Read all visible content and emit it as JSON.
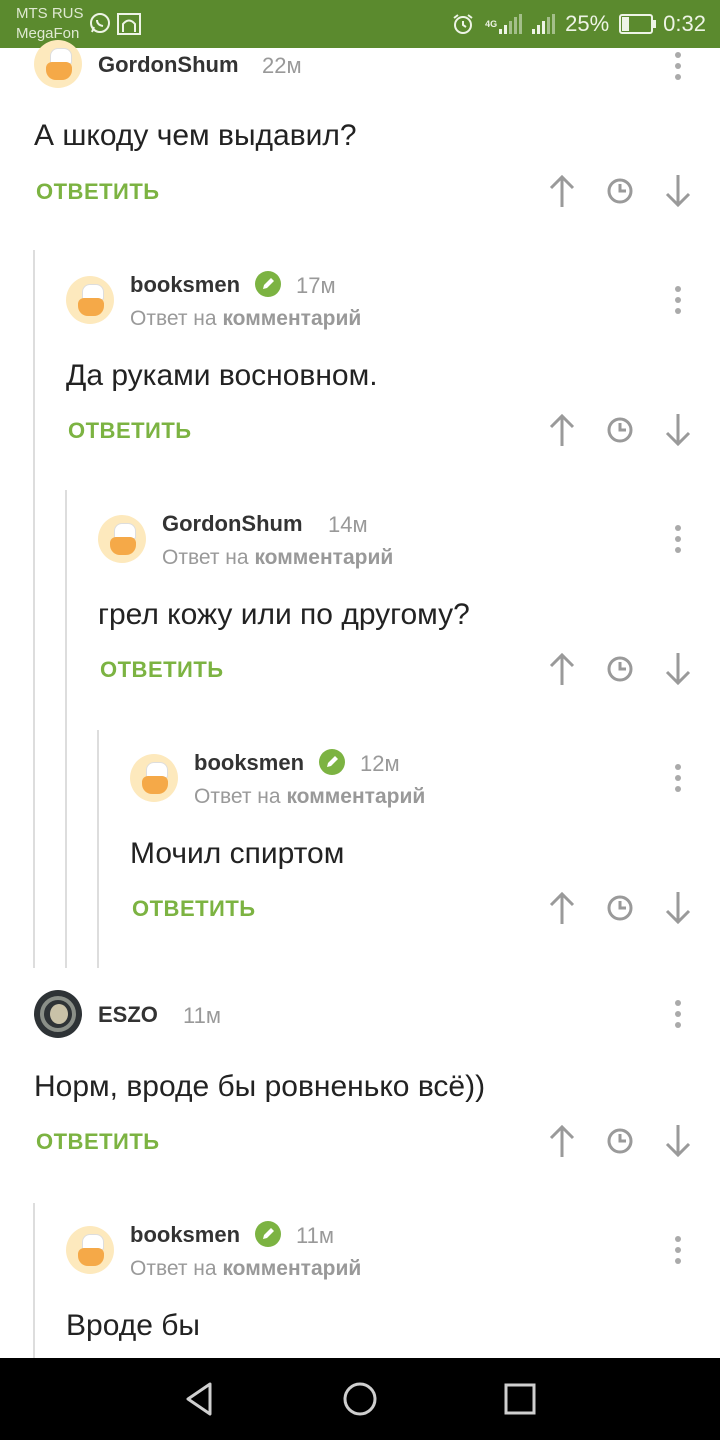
{
  "status_bar": {
    "carrier_line1": "MTS RUS",
    "carrier_line2": "MegaFon",
    "battery": "25%",
    "battery_level": 0.25,
    "clock": "0:32",
    "network": "4G"
  },
  "labels": {
    "reply": "ОТВЕТИТЬ",
    "reply_prefix": "Ответ на",
    "reply_target": "комментарий"
  },
  "comments": [
    {
      "author": "GordonShum",
      "time": "22м",
      "text": "А шкоду чем выдавил?",
      "verified": false
    },
    {
      "author": "booksmen",
      "time": "17м",
      "text": "Да руками восновном.",
      "verified": true
    },
    {
      "author": "GordonShum",
      "time": "14м",
      "text": "грел кожу или по другому?",
      "verified": false
    },
    {
      "author": "booksmen",
      "time": "12м",
      "text": "Мочил спиртом",
      "verified": true
    },
    {
      "author": "ESZO",
      "time": "11м",
      "text": "Норм, вроде бы ровненько всё))",
      "verified": false
    },
    {
      "author": "booksmen",
      "time": "11м",
      "text": "Вроде бы",
      "verified": true
    }
  ],
  "colors": {
    "status_bar": "#5b8a2e",
    "accent": "#7cb342",
    "muted": "#999999",
    "thread_line": "#dddddd"
  },
  "icons": {
    "upvote": "arrow-up-icon",
    "save": "clock-icon",
    "downvote": "arrow-down-icon",
    "menu": "more-vert-icon",
    "nav_back": "triangle-back-icon",
    "nav_home": "circle-home-icon",
    "nav_recents": "square-recents-icon"
  }
}
